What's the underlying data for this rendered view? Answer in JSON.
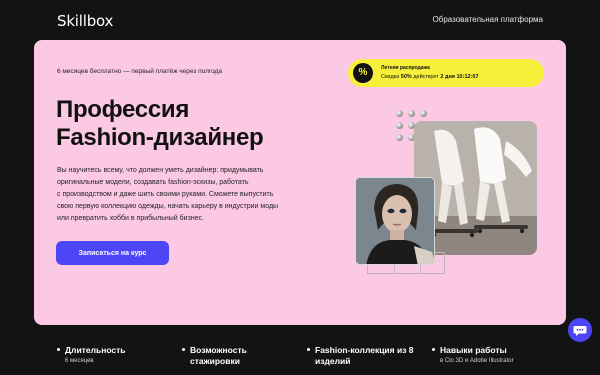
{
  "header": {
    "logo": "Skillbox",
    "platform_link": "Образовательная платформа"
  },
  "hero": {
    "tagline": "6 месяцев бесплатно — первый платёж через полгода",
    "title_line1": "Профессия",
    "title_line2": "Fashion-дизайнер",
    "description_lines": [
      "Вы научитесь всему, что должен уметь дизайнер: придумывать",
      "оригинальные модели, создавать fashion-эскизы, работать",
      "с производством и даже шить своими руками. Сможете выпустить",
      "свою первую коллекцию одежды, начать карьеру в индустрии моды",
      "или превратить хобби в прибыльный бизнес."
    ],
    "cta_label": "Записаться на курс",
    "sale": {
      "icon_glyph": "%",
      "title": "Летняя распродажа",
      "text_prefix": "Скидка ",
      "discount": "50%",
      "text_middle": " действует ",
      "timer": "2 дня 10:12:07"
    }
  },
  "features": [
    {
      "title": "Длительность",
      "subtitle": "6 месяцев"
    },
    {
      "title": "Возможность стажировки",
      "subtitle": ""
    },
    {
      "title": "Fashion-коллекция из 8 изделий",
      "subtitle": ""
    },
    {
      "title": "Навыки работы",
      "subtitle": "в Clo 3D и Adobe Illustrator"
    }
  ],
  "colors": {
    "page_bg": "#131313",
    "hero_bg": "#fcc9e5",
    "accent": "#4c46f7",
    "sale_bg": "#f7f03a"
  },
  "icons": {
    "sale": "percent-icon",
    "chat": "chat-icon"
  }
}
